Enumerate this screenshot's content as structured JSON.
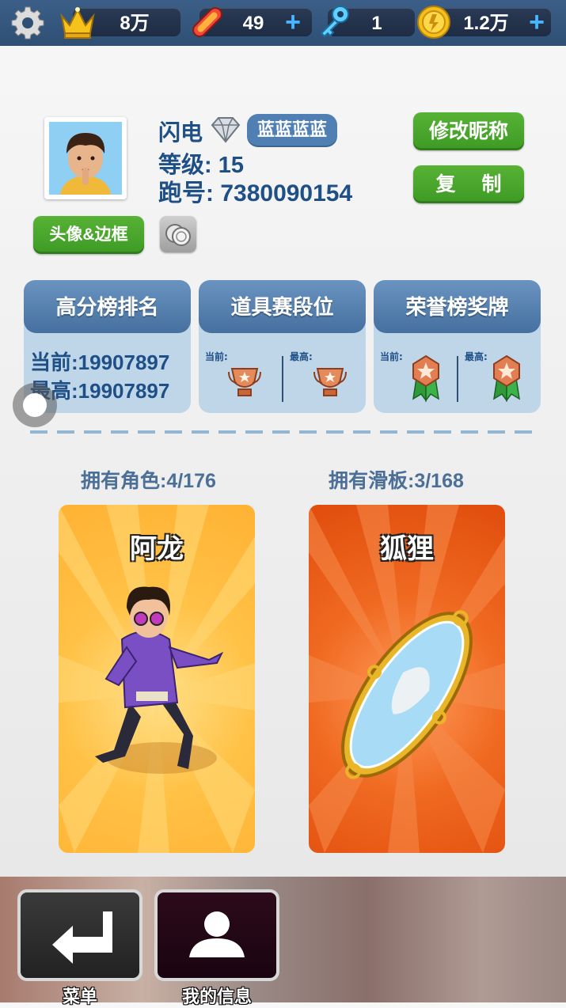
{
  "topbar": {
    "crowns": "8万",
    "boards": "49",
    "keys": "1",
    "coins": "1.2万",
    "plus": "+"
  },
  "profile": {
    "name": "闪电",
    "tag": "蓝蓝蓝蓝",
    "level_line": "等级: 15",
    "run_id_line": "跑号: 7380090154",
    "rename_button": "修改昵称",
    "copy_button": "复 制",
    "avatar_button": "头像&边框"
  },
  "stats": {
    "highscore": {
      "title": "高分榜排名",
      "current": "当前:19907897",
      "best": "最高:19907897"
    },
    "items": {
      "title": "道具赛段位",
      "current_label": "当前:",
      "best_label": "最高:"
    },
    "honor": {
      "title": "荣誉榜奖牌",
      "current_label": "当前:",
      "best_label": "最高:"
    }
  },
  "collection": {
    "characters_owned": "拥有角色:4/176",
    "boards_owned": "拥有滑板:3/168",
    "character_name": "阿龙",
    "board_name": "狐狸"
  },
  "bottom": {
    "menu_label": "菜单",
    "myinfo_label": "我的信息"
  },
  "colors": {
    "topbar": "#2f4f74",
    "text_blue": "#1e4f86",
    "green_button": "#3d9a24",
    "character_card": "#ffb233",
    "board_card": "#e8520f"
  }
}
